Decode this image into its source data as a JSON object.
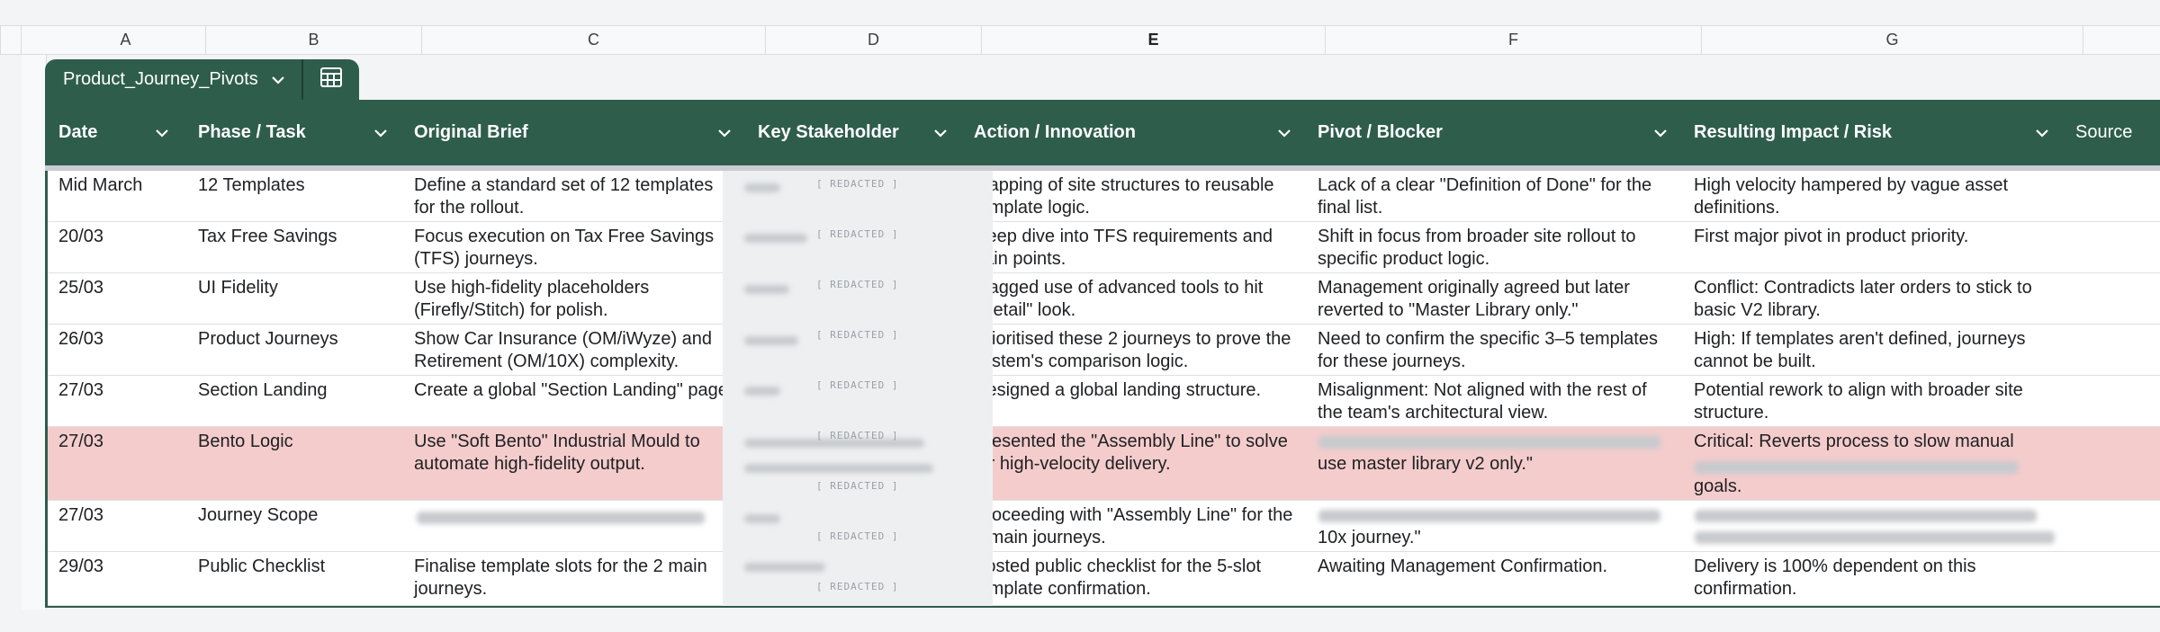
{
  "column_letters": [
    "A",
    "B",
    "C",
    "D",
    "E",
    "F",
    "G"
  ],
  "table": {
    "name": "Product_Journey_Pivots",
    "dropdown_icon": "chevron-down-icon",
    "calc_icon": "table-calculator-icon"
  },
  "headers": [
    "Date",
    "Phase / Task",
    "Original Brief",
    "Key Stakeholder",
    "Action / Innovation",
    "Pivot / Blocker",
    "Resulting Impact / Risk",
    "Source"
  ],
  "redacted_label": "[ REDACTED ]",
  "rows": [
    {
      "date": "Mid March",
      "phase": "12 Templates",
      "brief": "Define a standard set of 12 templates for the rollout.",
      "action": "Mapping of site structures to reusable template logic.",
      "pivot": "Lack of a clear \"Definition of Done\" for the final list.",
      "impact": "High velocity hampered by vague asset definitions."
    },
    {
      "date": "20/03",
      "phase": "Tax Free Savings",
      "brief": "Focus execution on Tax Free Savings (TFS) journeys.",
      "action": "Deep dive into TFS requirements and pain points.",
      "pivot": "Shift in focus from broader site rollout to specific product logic.",
      "impact": "First major pivot in product priority."
    },
    {
      "date": "25/03",
      "phase": "UI Fidelity",
      "brief": "Use high-fidelity placeholders (Firefly/Stitch) for polish.",
      "action": "Flagged use of advanced tools to hit \"Retail\" look.",
      "pivot": "Management originally agreed but later reverted to \"Master Library only.\"",
      "impact": "Conflict: Contradicts later orders to stick to basic V2 library."
    },
    {
      "date": "26/03",
      "phase": "Product Journeys",
      "brief": "Show Car Insurance (OM/iWyze) and Retirement (OM/10X) complexity.",
      "action": "Prioritised these 2 journeys to prove the system's comparison logic.",
      "pivot": "Need to confirm the specific 3–5 templates for these journeys.",
      "impact": "High: If templates aren't defined, journeys cannot be built."
    },
    {
      "date": "27/03",
      "phase": "Section Landing",
      "brief": "Create a global \"Section Landing\" page.",
      "action": "Designed a global landing structure.",
      "pivot": "Misalignment: Not aligned with the rest of the team's architectural view.",
      "impact": "Potential rework to align with broader site structure."
    },
    {
      "date": "27/03",
      "phase": "Bento Logic",
      "brief": "Use \"Soft Bento\" Industrial Mould to automate high-fidelity output.",
      "action": "Presented the \"Assembly Line\" to solve for high-velocity delivery.",
      "pivot": "use master library v2 only.\"",
      "impact": "Critical: Reverts process to slow manual goals."
    },
    {
      "date": "27/03",
      "phase": "Journey Scope",
      "brief": "",
      "action": "Proceeding with \"Assembly Line\" for the 2 main journeys.",
      "pivot": "10x journey.\"",
      "impact": ""
    },
    {
      "date": "29/03",
      "phase": "Public Checklist",
      "brief": "Finalise template slots for the 2 main journeys.",
      "action": "Posted public checklist for the 5-slot template confirmation.",
      "pivot": "Awaiting Management Confirmation.",
      "impact": "Delivery is 100% dependent on this confirmation."
    }
  ]
}
